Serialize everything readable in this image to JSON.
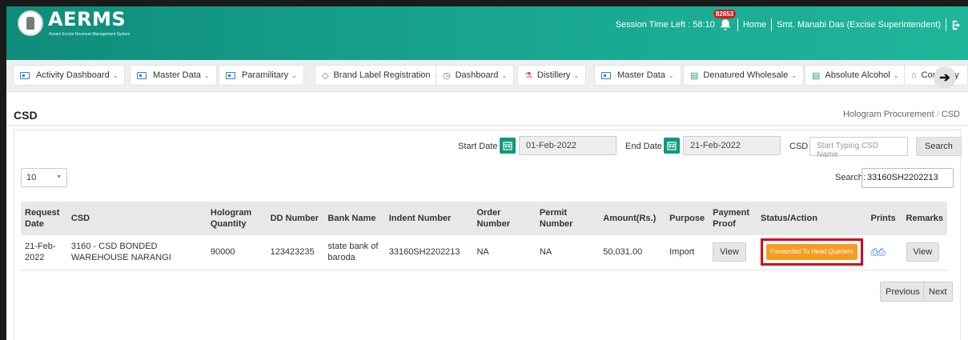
{
  "header": {
    "app_name": "AERMS",
    "app_subtitle": "Assam Excise Revenue Management System",
    "session_label": "Session Time Left : 58:10",
    "notification_count": "82653",
    "home_label": "Home",
    "user_label": "Smt. Manabi Das (Excise Superintendent)"
  },
  "nav": {
    "items": [
      {
        "label": "Activity Dashboard"
      },
      {
        "label": "Master Data"
      },
      {
        "label": "Paramilitary"
      },
      {
        "label": "Brand Label Registration"
      },
      {
        "label": "Dashboard"
      },
      {
        "label": "Distillery"
      },
      {
        "label": "Master Data"
      },
      {
        "label": "Denatured Wholesale"
      },
      {
        "label": "Absolute Alcohol"
      },
      {
        "label": "Company"
      }
    ]
  },
  "page": {
    "title": "CSD",
    "breadcrumb": [
      "Hologram Procurement",
      "CSD"
    ]
  },
  "filters": {
    "start_label": "Start Date",
    "start_value": "01-Feb-2022",
    "end_label": "End Date",
    "end_value": "21-Feb-2022",
    "csd_label": "CSD",
    "csd_placeholder": "Start Typing CSD Name",
    "search_button": "Search"
  },
  "table_controls": {
    "page_length": "10",
    "search_label": "Search:",
    "search_value": "33160SH2202213"
  },
  "table": {
    "headers": [
      "Request Date",
      "CSD",
      "Hologram Quantity",
      "DD Number",
      "Bank Name",
      "Indent Number",
      "Order Number",
      "Permit Number",
      "Amount(Rs.)",
      "Purpose",
      "Payment Proof",
      "Status/Action",
      "Prints",
      "Remarks"
    ],
    "rows": [
      {
        "request_date": "21-Feb-2022",
        "csd": "3160 - CSD BONDED WAREHOUSE NARANGI",
        "hologram_quantity": "90000",
        "dd_number": "123423235",
        "bank_name": "state bank of baroda",
        "indent_number": "33160SH2202213",
        "order_number": "NA",
        "permit_number": "NA",
        "amount": "50,031.00",
        "purpose": "Import",
        "payment_proof": "View",
        "status": "Forwarded To Head Quarters",
        "remarks": "View"
      }
    ]
  },
  "pagination": {
    "previous": "Previous",
    "next": "Next"
  },
  "colors": {
    "header_teal": "#18a58f",
    "status_orange": "#f49d20",
    "highlight_red": "#d9001b",
    "print_blue": "#1d63c7"
  }
}
